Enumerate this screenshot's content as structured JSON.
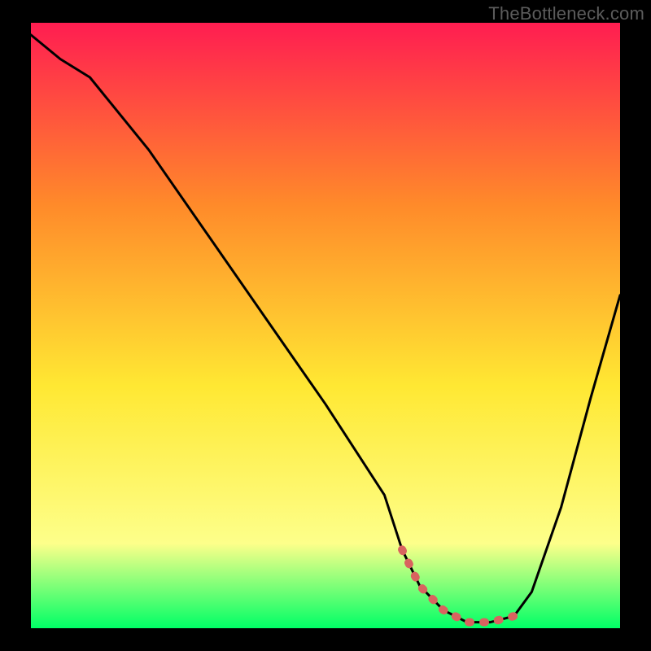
{
  "watermark": "TheBottleneck.com",
  "colors": {
    "bg": "#000000",
    "gradient_top": "#ff1d51",
    "gradient_mid1": "#ff8a2a",
    "gradient_mid2": "#ffe833",
    "gradient_mid3": "#fdff8a",
    "gradient_bottom": "#00ff66",
    "curve": "#000000",
    "highlight": "#d9635f"
  },
  "chart_data": {
    "type": "line",
    "title": "",
    "xlabel": "",
    "ylabel": "",
    "xlim": [
      0,
      100
    ],
    "ylim": [
      0,
      100
    ],
    "series": [
      {
        "name": "bottleneck-curve",
        "x": [
          0,
          5,
          10,
          20,
          30,
          40,
          50,
          60,
          63,
          66,
          70,
          74,
          78,
          82,
          85,
          90,
          95,
          100
        ],
        "values": [
          98,
          94,
          91,
          79,
          65,
          51,
          37,
          22,
          13,
          7,
          3,
          1,
          1,
          2,
          6,
          20,
          38,
          55
        ]
      }
    ],
    "highlight_segment": {
      "name": "optimal-range",
      "x": [
        63,
        66,
        70,
        74,
        78,
        82
      ],
      "values": [
        13,
        7,
        3,
        1,
        1,
        2
      ]
    }
  }
}
